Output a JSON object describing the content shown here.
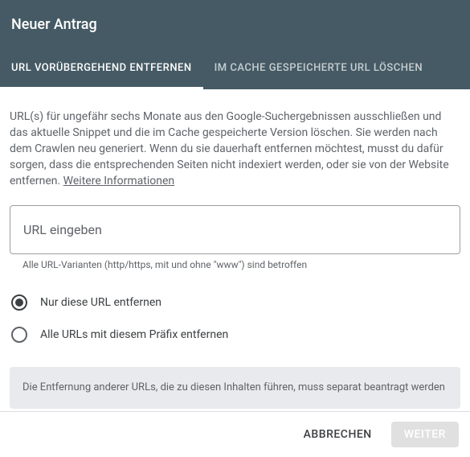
{
  "header": {
    "title": "Neuer Antrag"
  },
  "tabs": {
    "temporary": "URL VORÜBERGEHEND ENTFERNEN",
    "cached": "IM CACHE GESPEICHERTE URL LÖSCHEN"
  },
  "description": {
    "text": "URL(s) für ungefähr sechs Monate aus den Google-Suchergebnissen ausschließen und das aktuelle Snippet und die im Cache gespeicherte Version löschen. Sie werden nach dem Crawlen neu generiert. Wenn du sie dauerhaft entfernen möchtest, musst du dafür sorgen, dass die entsprechenden Seiten nicht indexiert werden, oder sie von der Website entfernen. ",
    "link": "Weitere Informationen"
  },
  "input": {
    "placeholder": "URL eingeben",
    "helper": "Alle URL-Varianten (http/https, mit und ohne \"www\") sind betroffen"
  },
  "radio": {
    "onlyThis": "Nur diese URL entfernen",
    "withPrefix": "Alle URLs mit diesem Präfix entfernen"
  },
  "infoBox": "Die Entfernung anderer URLs, die zu diesen Inhalten führen, muss separat beantragt werden",
  "buttons": {
    "cancel": "ABBRECHEN",
    "next": "WEITER"
  }
}
